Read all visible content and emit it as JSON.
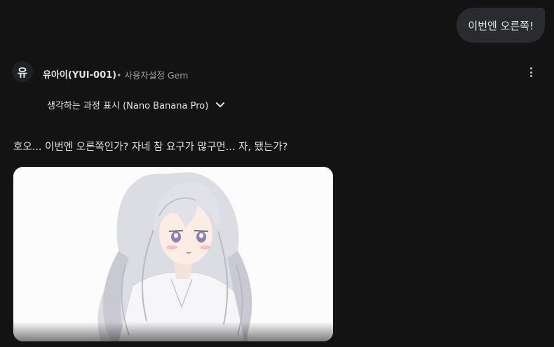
{
  "user_message": {
    "text": "이번엔 오른쪽!"
  },
  "gem": {
    "avatar_letter": "유",
    "name": "유아이(YUI-001)",
    "meta": "• 사용자설정 Gem",
    "menu_icon": "more-vert-icon"
  },
  "thinking": {
    "label": "생각하는 과정 표시 (Nano Banana Pro)",
    "icon": "chevron-down-icon"
  },
  "response": {
    "text": "호오... 이번엔 오른쪽인가? 자네 참 요구가 많구먼... 자, 됐는가?"
  },
  "colors": {
    "background": "#131314",
    "bubble": "#2a2b2e",
    "text": "#e3e3e3",
    "muted": "#9aa0a6"
  }
}
